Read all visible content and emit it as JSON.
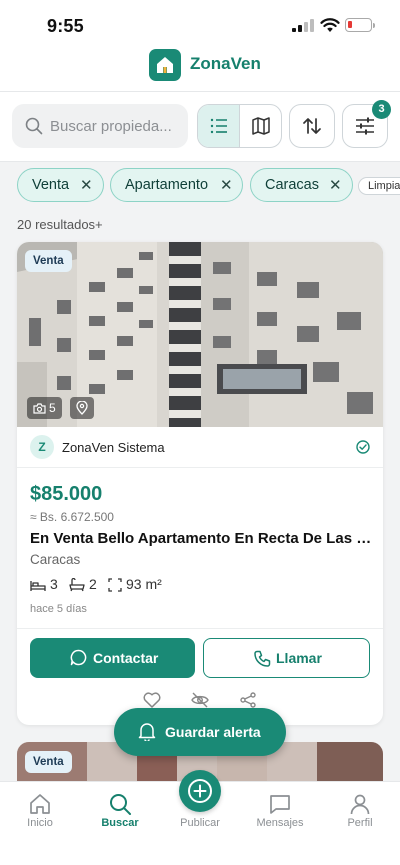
{
  "status_bar": {
    "time": "9:55"
  },
  "header": {
    "brand": "ZonaVen"
  },
  "search": {
    "placeholder": "Buscar propieda..."
  },
  "filters": {
    "badge_count": "3"
  },
  "chips": [
    {
      "label": "Venta"
    },
    {
      "label": "Apartamento"
    },
    {
      "label": "Caracas"
    }
  ],
  "clear_label": "Limpia",
  "results_text": "20 resultados+",
  "listing": {
    "tag": "Venta",
    "photo_count": "5",
    "agent_initial": "Z",
    "agent_name": "ZonaVen Sistema",
    "price": "$85.000",
    "price_bs": "≈ Bs. 6.672.500",
    "title": "En Venta Bello Apartamento En Recta De Las M...",
    "city": "Caracas",
    "bedrooms": "3",
    "bathrooms": "2",
    "area": "93 m²",
    "posted": "hace 5 días",
    "contact_label": "Contactar",
    "call_label": "Llamar"
  },
  "alert_button": "Guardar alerta",
  "next_listing": {
    "tag": "Venta"
  },
  "tabbar": [
    {
      "label": "Inicio"
    },
    {
      "label": "Buscar"
    },
    {
      "label": "Publicar"
    },
    {
      "label": "Mensajes"
    },
    {
      "label": "Perfil"
    }
  ],
  "colors": {
    "accent": "#1a8a76",
    "chip_bg": "#e3f5f1",
    "chip_border": "#8dd3c6",
    "battery_low": "#e53935"
  }
}
